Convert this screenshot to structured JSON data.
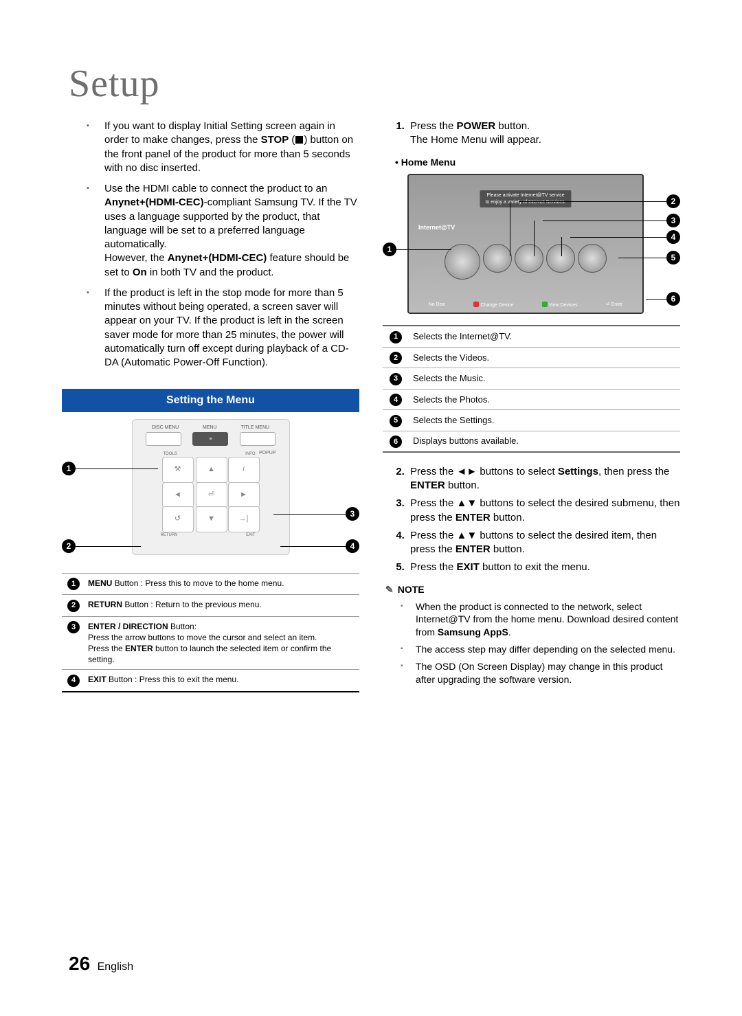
{
  "page": {
    "title": "Setup",
    "number": "26",
    "language": "English"
  },
  "left": {
    "bullets": [
      {
        "pre": "If you want to display Initial Setting screen again in order to make changes, press the ",
        "b1": "STOP",
        "mid": " (",
        "icon": "stop",
        "post": ") button on the front panel of the product for more than 5 seconds with no disc inserted."
      },
      {
        "pre": "Use the HDMI cable to connect the product to an ",
        "b1": "Anynet+(HDMI-CEC)",
        "mid": "-compliant Samsung TV. If the TV uses a language supported by the product, that language will be set to a preferred language automatically.\nHowever, the ",
        "b2": "Anynet+(HDMI-CEC)",
        "mid2": " feature should be set to ",
        "b3": "On",
        "post": " in both TV and the product."
      },
      {
        "post": "If the product is left in the stop mode for more than 5 minutes without being operated, a screen saver will appear on your TV. If the product is left in the screen saver mode for more than 25 minutes, the power will automatically turn off except during playback of a CD-DA (Automatic Power-Off Function)."
      }
    ],
    "section_title": "Setting the Menu",
    "remote": {
      "top_labels": [
        "DISC MENU",
        "MENU",
        "TITLE MENU"
      ],
      "btn2": "POPUP",
      "dpad": {
        "tools": "TOOLS",
        "info": "INFO",
        "return": "RETURN",
        "exit": "EXIT"
      }
    },
    "table": [
      {
        "n": "1",
        "b": "MENU",
        "text": " Button : Press this to move to the home menu."
      },
      {
        "n": "2",
        "b": "RETURN",
        "text": " Button : Return to the previous menu."
      },
      {
        "n": "3",
        "b": "ENTER / DIRECTION",
        "text": " Button:\nPress the arrow buttons to move the cursor and select an item.\nPress the ",
        "b2": "ENTER",
        "text2": " button to launch the selected item or confirm the setting."
      },
      {
        "n": "4",
        "b": "EXIT",
        "text": " Button : Press this to exit the menu."
      }
    ]
  },
  "right": {
    "step1": {
      "pre": "Press the ",
      "b": "POWER",
      "mid": " button.\nThe Home Menu will appear."
    },
    "home_menu_label": "• Home Menu",
    "tv": {
      "banner": "Please activate Internet@TV service\nto enjoy a variety of Internet Services.",
      "label": "Internet@TV",
      "bottom": {
        "nodisc": "No Disc",
        "change": "Change Device",
        "view": "View Devices",
        "enter": "Enter"
      }
    },
    "tv_table": [
      {
        "n": "1",
        "t": "Selects the Internet@TV."
      },
      {
        "n": "2",
        "t": "Selects the Videos."
      },
      {
        "n": "3",
        "t": "Selects the Music."
      },
      {
        "n": "4",
        "t": "Selects the Photos."
      },
      {
        "n": "5",
        "t": "Selects the Settings."
      },
      {
        "n": "6",
        "t": "Displays buttons available."
      }
    ],
    "steps_rest": [
      {
        "pre": "Press the ",
        "sym": "◄►",
        "mid": " buttons to select ",
        "b": "Settings",
        "mid2": ", then press the ",
        "b2": "ENTER",
        "post": " button."
      },
      {
        "pre": "Press the ",
        "sym": "▲▼",
        "mid": " buttons to select the desired submenu, then press the ",
        "b": "ENTER",
        "post": " button."
      },
      {
        "pre": "Press the ",
        "sym": "▲▼",
        "mid": " buttons to select the desired item, then press the ",
        "b": "ENTER",
        "post": " button."
      },
      {
        "pre": "Press the ",
        "b": "EXIT",
        "post": " button to exit the menu."
      }
    ],
    "note_label": "NOTE",
    "notes": [
      {
        "pre": "When the product is connected to the network, select Internet@TV from the home menu. Download desired content from ",
        "b": "Samsung AppS",
        "post": "."
      },
      {
        "post": "The access step may differ depending on the selected menu."
      },
      {
        "post": "The OSD (On Screen Display) may change in this product after upgrading the software version."
      }
    ]
  }
}
